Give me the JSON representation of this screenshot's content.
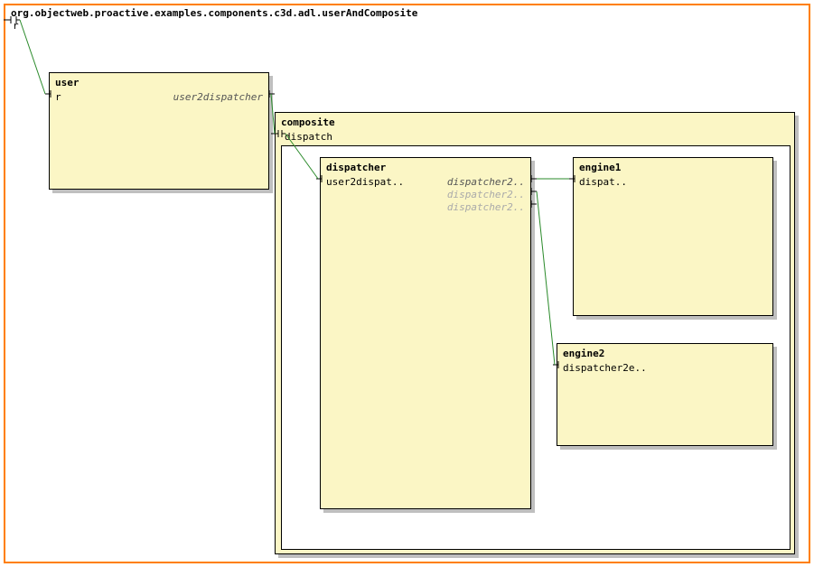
{
  "root": {
    "title": "org.objectweb.proactive.examples.components.c3d.adl.userAndComposite",
    "port_r": "r"
  },
  "user": {
    "name": "user",
    "port_left": "r",
    "port_right": "user2dispatcher"
  },
  "composite": {
    "name": "composite",
    "port_dispatch": "dispatch"
  },
  "dispatcher": {
    "name": "dispatcher",
    "port_left": "user2dispat..",
    "port_r1": "dispatcher2..",
    "port_r2": "dispatcher2..",
    "port_r3": "dispatcher2.."
  },
  "engine1": {
    "name": "engine1",
    "port_left": "dispat.."
  },
  "engine2": {
    "name": "engine2",
    "port_left": "dispatcher2e.."
  }
}
